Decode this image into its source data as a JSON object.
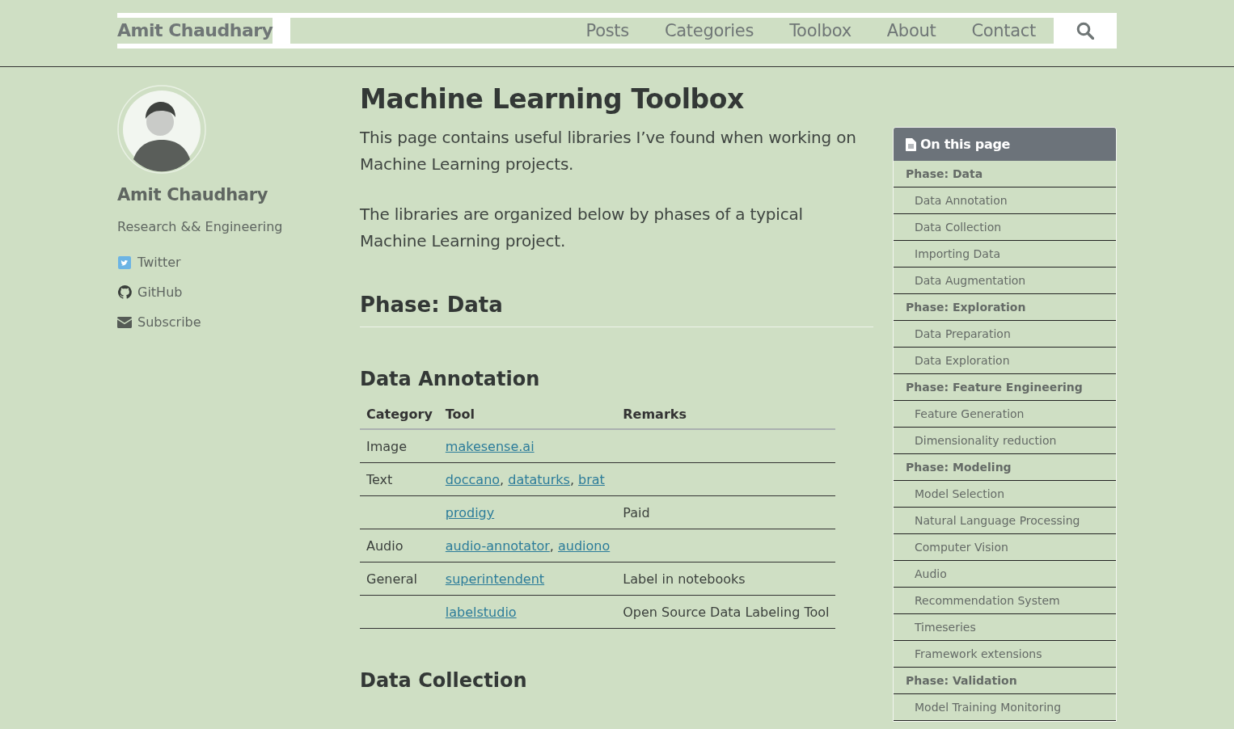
{
  "navbar": {
    "brand": "Amit Chaudhary",
    "links": [
      {
        "label": "Posts",
        "selected": false
      },
      {
        "label": "Categories",
        "selected": false
      },
      {
        "label": "Toolbox",
        "selected": false
      },
      {
        "label": "About",
        "selected": false
      },
      {
        "label": "Contact",
        "selected": false
      }
    ]
  },
  "profile": {
    "name": "Amit Chaudhary",
    "tagline": "Research && Engineering",
    "links": [
      {
        "label": "Twitter",
        "kind": "twitter"
      },
      {
        "label": "GitHub",
        "kind": "github"
      },
      {
        "label": "Subscribe",
        "kind": "email"
      }
    ]
  },
  "article": {
    "title": "Machine Learning Toolbox",
    "paragraphs": [
      "This page contains useful libraries I’ve found when working on Machine Learning projects.",
      "The libraries are organized below by phases of a typical Machine Learning project."
    ],
    "phase_heading": "Phase: Data",
    "section_heading": "Data Annotation",
    "table": {
      "columns": [
        "Category",
        "Tool",
        "Remarks"
      ],
      "tool_separator": ", ",
      "rows": [
        {
          "category": "Image",
          "tools": [
            "makesense.ai"
          ]
        },
        {
          "category": "Text",
          "tools": [
            "doccano",
            "dataturks",
            "brat"
          ]
        },
        {
          "tools": [
            "prodigy"
          ],
          "remarks": "Paid"
        },
        {
          "category": "Audio",
          "tools": [
            "audio-annotator",
            "audiono"
          ]
        },
        {
          "category": "General",
          "tools": [
            "superintendent"
          ],
          "remarks": "Label in notebooks"
        },
        {
          "tools": [
            "labelstudio"
          ],
          "remarks": "Open Source Data Labeling Tool"
        }
      ]
    },
    "next_heading": "Data Collection"
  },
  "toc": {
    "title": "On this page",
    "items": [
      {
        "label": "Phase: Data",
        "kind": "phase"
      },
      {
        "label": "Data Annotation",
        "kind": "topic"
      },
      {
        "label": "Data Collection",
        "kind": "topic"
      },
      {
        "label": "Importing Data",
        "kind": "topic"
      },
      {
        "label": "Data Augmentation",
        "kind": "topic"
      },
      {
        "label": "Phase: Exploration",
        "kind": "phase"
      },
      {
        "label": "Data Preparation",
        "kind": "topic"
      },
      {
        "label": "Data Exploration",
        "kind": "topic"
      },
      {
        "label": "Phase: Feature Engineering",
        "kind": "phase"
      },
      {
        "label": "Feature Generation",
        "kind": "topic"
      },
      {
        "label": "Dimensionality reduction",
        "kind": "topic"
      },
      {
        "label": "Phase: Modeling",
        "kind": "phase"
      },
      {
        "label": "Model Selection",
        "kind": "topic"
      },
      {
        "label": "Natural Language Processing",
        "kind": "topic"
      },
      {
        "label": "Computer Vision",
        "kind": "topic"
      },
      {
        "label": "Audio",
        "kind": "topic"
      },
      {
        "label": "Recommendation System",
        "kind": "topic"
      },
      {
        "label": "Timeseries",
        "kind": "topic"
      },
      {
        "label": "Framework extensions",
        "kind": "topic"
      },
      {
        "label": "Phase: Validation",
        "kind": "phase"
      },
      {
        "label": "Model Training Monitoring",
        "kind": "topic"
      }
    ]
  }
}
